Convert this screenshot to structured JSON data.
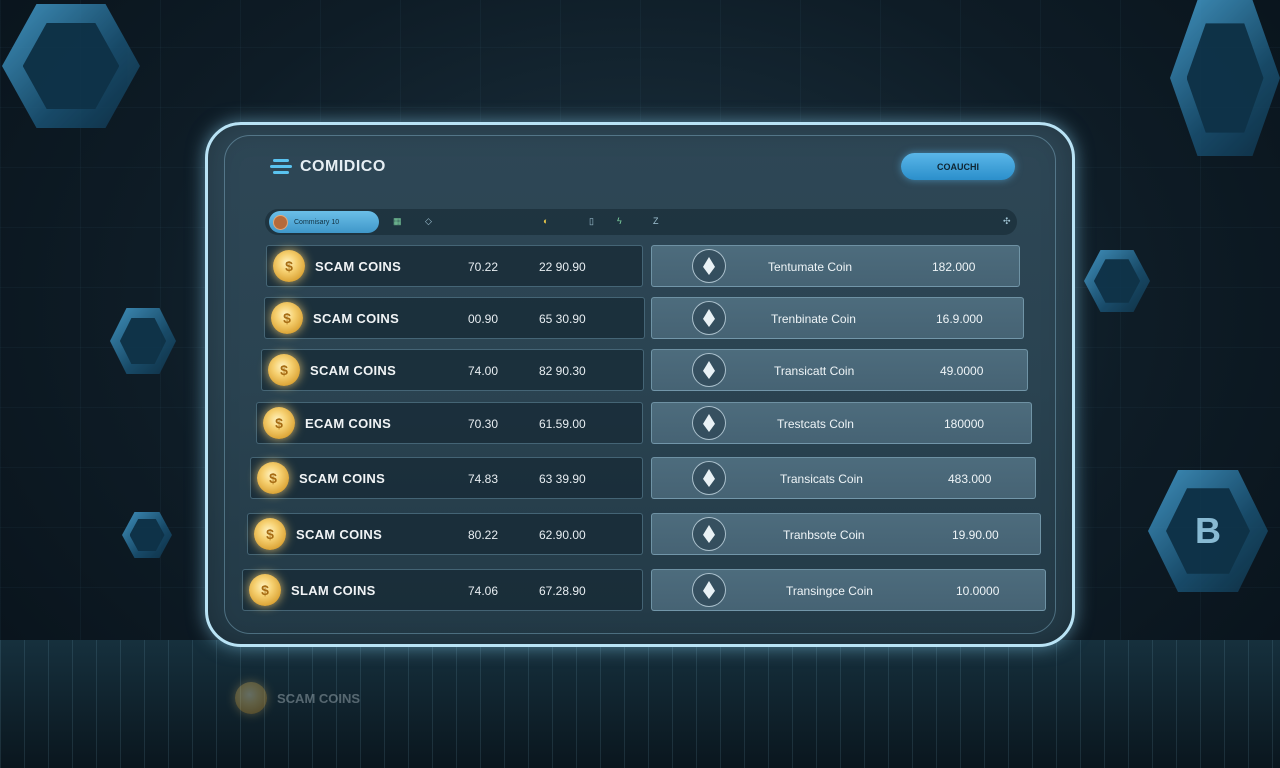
{
  "brand": {
    "name": "COMIDICO",
    "logo_icon": "layers-icon"
  },
  "header": {
    "cta_label": "COAUCHI"
  },
  "toolbar": {
    "pill_label": "Commisary 10",
    "items": [
      {
        "icon": "grid-icon",
        "label": ""
      },
      {
        "icon": "shield-icon",
        "label": ""
      },
      {
        "icon": "coin-status-icon",
        "label": ""
      },
      {
        "icon": "bar-icon",
        "label": ""
      },
      {
        "icon": "bolt-icon",
        "label": ""
      },
      {
        "icon": "z-icon",
        "label": ""
      }
    ],
    "settings_icon": "gear-icon"
  },
  "rows_left": [
    {
      "name": "SCAM COINS",
      "value1": "70.22",
      "value2": "22 90.90"
    },
    {
      "name": "SCAM COINS",
      "value1": "00.90",
      "value2": "65 30.90"
    },
    {
      "name": "SCAM COINS",
      "value1": "74.00",
      "value2": "82 90.30"
    },
    {
      "name": "ECAM COINS",
      "value1": "70.30",
      "value2": "61.59.00"
    },
    {
      "name": "SCAM COINS",
      "value1": "74.83",
      "value2": "63 39.90"
    },
    {
      "name": "SCAM COINS",
      "value1": "80.22",
      "value2": "62.90.00"
    },
    {
      "name": "SLAM COINS",
      "value1": "74.06",
      "value2": "67.28.90"
    }
  ],
  "rows_right": [
    {
      "name": "Tentumate Coin",
      "value": "182.000"
    },
    {
      "name": "Trenbinate Coin",
      "value": "16.9.000"
    },
    {
      "name": "Transicatt Coin",
      "value": "49.0000"
    },
    {
      "name": "Trestcats Coln",
      "value": "180000"
    },
    {
      "name": "Transicats Coin",
      "value": "483.000"
    },
    {
      "name": "Tranbsote Coin",
      "value": "19.90.00"
    },
    {
      "name": "Transingce Coin",
      "value": "10.0000"
    }
  ],
  "reflection_text": "SCAM COINS",
  "colors": {
    "accent": "#4aa6d8",
    "panel": "#2a4351",
    "coin": "#f6d070"
  }
}
